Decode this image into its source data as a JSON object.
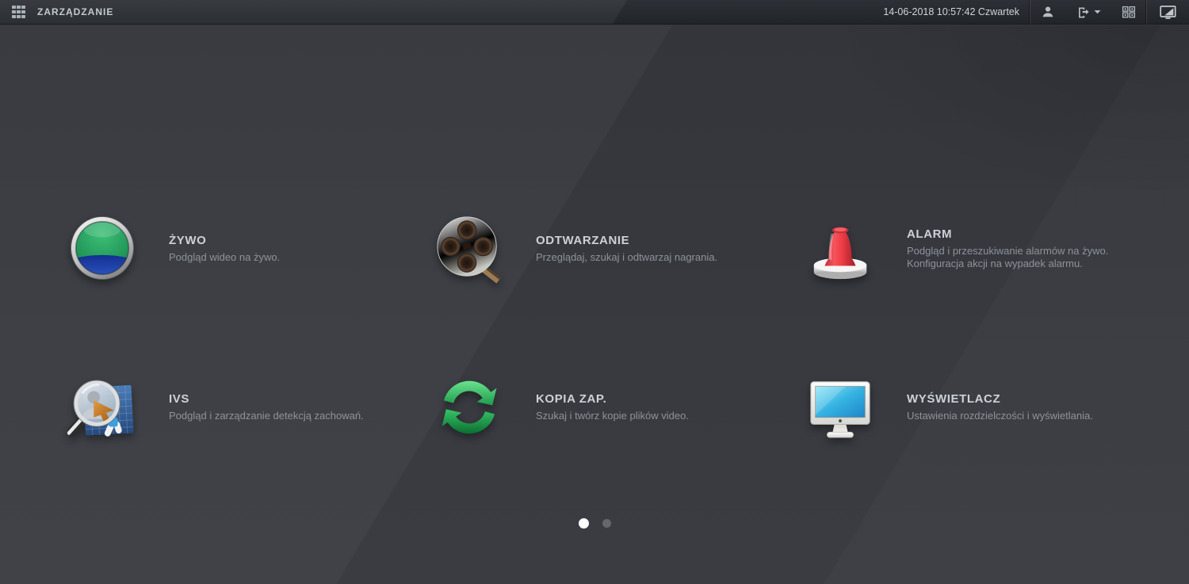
{
  "topbar": {
    "title": "ZARZĄDZANIE",
    "datetime": "14-06-2018 10:57:42 Czwartek",
    "icons": [
      "apps-grid",
      "user",
      "logout",
      "caret-down",
      "screen-layout",
      "monitor-switch"
    ]
  },
  "menu": {
    "items": [
      {
        "title": "ŻYWO",
        "desc1": "Podgląd wideo na żywo.",
        "icon": "live-lens"
      },
      {
        "title": "ODTWARZANIE",
        "desc1": "Przeglądaj, szukaj i odtwarzaj nagrania.",
        "icon": "film-reel"
      },
      {
        "title": "ALARM",
        "desc1": "Podgląd i przeszukiwanie alarmów na żywo.",
        "desc2": "Konfiguracja akcji na wypadek alarmu.",
        "icon": "red-siren"
      },
      {
        "title": "IVS",
        "desc1": "Podgląd i zarządzanie detekcją zachowań.",
        "icon": "magnifier-detection"
      },
      {
        "title": "KOPIA ZAP.",
        "desc1": "Szukaj i twórz kopie plików video.",
        "icon": "green-sync-arrows"
      },
      {
        "title": "WYŚWIETLACZ",
        "desc1": "Ustawienia rozdzielczości i wyświetlania.",
        "icon": "blue-monitor"
      }
    ]
  },
  "pagination": {
    "total_pages": 2,
    "active_index": 0
  },
  "colors": {
    "topbar_bg": "#26292e",
    "background": "#35373d",
    "title_text": "#cdd2d8",
    "desc_text": "#8d9299",
    "accent_green": "#2fae66",
    "accent_blue": "#1d3fae",
    "accent_red": "#e03c46",
    "accent_cyan": "#35c4e8",
    "dot_active": "#fdfdfd",
    "dot_inactive": "#64676d"
  }
}
